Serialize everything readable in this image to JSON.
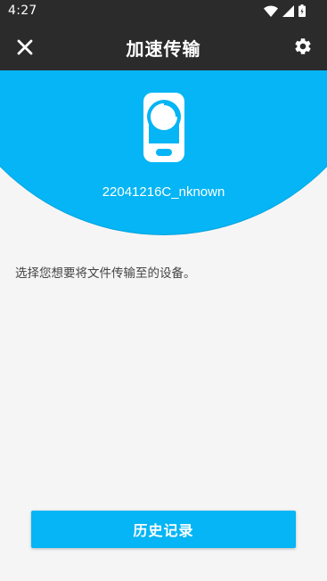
{
  "status_bar": {
    "time": "4:27",
    "icons": [
      "wifi-icon",
      "signal-icon",
      "battery-icon"
    ]
  },
  "toolbar": {
    "title": "加速传输",
    "close_icon": "close-icon",
    "settings_icon": "gear-icon"
  },
  "device": {
    "name": "22041216C_nknown",
    "icon": "phone-icon"
  },
  "instruction": "选择您想要将文件传输至的设备。",
  "history_button": {
    "label": "历史记录"
  },
  "colors": {
    "accent": "#05b5f5",
    "toolbar": "#2b2b2b",
    "background": "#f5f5f5"
  }
}
